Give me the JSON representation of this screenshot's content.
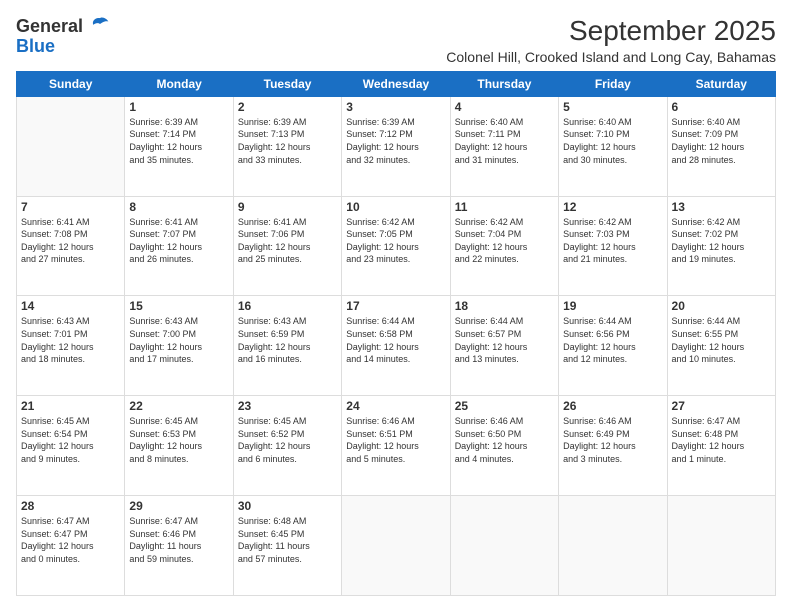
{
  "header": {
    "logo": {
      "general": "General",
      "blue": "Blue"
    },
    "title": "September 2025",
    "subtitle": "Colonel Hill, Crooked Island and Long Cay, Bahamas"
  },
  "calendar": {
    "days_of_week": [
      "Sunday",
      "Monday",
      "Tuesday",
      "Wednesday",
      "Thursday",
      "Friday",
      "Saturday"
    ],
    "weeks": [
      [
        {
          "day": "",
          "info": ""
        },
        {
          "day": "1",
          "info": "Sunrise: 6:39 AM\nSunset: 7:14 PM\nDaylight: 12 hours\nand 35 minutes."
        },
        {
          "day": "2",
          "info": "Sunrise: 6:39 AM\nSunset: 7:13 PM\nDaylight: 12 hours\nand 33 minutes."
        },
        {
          "day": "3",
          "info": "Sunrise: 6:39 AM\nSunset: 7:12 PM\nDaylight: 12 hours\nand 32 minutes."
        },
        {
          "day": "4",
          "info": "Sunrise: 6:40 AM\nSunset: 7:11 PM\nDaylight: 12 hours\nand 31 minutes."
        },
        {
          "day": "5",
          "info": "Sunrise: 6:40 AM\nSunset: 7:10 PM\nDaylight: 12 hours\nand 30 minutes."
        },
        {
          "day": "6",
          "info": "Sunrise: 6:40 AM\nSunset: 7:09 PM\nDaylight: 12 hours\nand 28 minutes."
        }
      ],
      [
        {
          "day": "7",
          "info": "Sunrise: 6:41 AM\nSunset: 7:08 PM\nDaylight: 12 hours\nand 27 minutes."
        },
        {
          "day": "8",
          "info": "Sunrise: 6:41 AM\nSunset: 7:07 PM\nDaylight: 12 hours\nand 26 minutes."
        },
        {
          "day": "9",
          "info": "Sunrise: 6:41 AM\nSunset: 7:06 PM\nDaylight: 12 hours\nand 25 minutes."
        },
        {
          "day": "10",
          "info": "Sunrise: 6:42 AM\nSunset: 7:05 PM\nDaylight: 12 hours\nand 23 minutes."
        },
        {
          "day": "11",
          "info": "Sunrise: 6:42 AM\nSunset: 7:04 PM\nDaylight: 12 hours\nand 22 minutes."
        },
        {
          "day": "12",
          "info": "Sunrise: 6:42 AM\nSunset: 7:03 PM\nDaylight: 12 hours\nand 21 minutes."
        },
        {
          "day": "13",
          "info": "Sunrise: 6:42 AM\nSunset: 7:02 PM\nDaylight: 12 hours\nand 19 minutes."
        }
      ],
      [
        {
          "day": "14",
          "info": "Sunrise: 6:43 AM\nSunset: 7:01 PM\nDaylight: 12 hours\nand 18 minutes."
        },
        {
          "day": "15",
          "info": "Sunrise: 6:43 AM\nSunset: 7:00 PM\nDaylight: 12 hours\nand 17 minutes."
        },
        {
          "day": "16",
          "info": "Sunrise: 6:43 AM\nSunset: 6:59 PM\nDaylight: 12 hours\nand 16 minutes."
        },
        {
          "day": "17",
          "info": "Sunrise: 6:44 AM\nSunset: 6:58 PM\nDaylight: 12 hours\nand 14 minutes."
        },
        {
          "day": "18",
          "info": "Sunrise: 6:44 AM\nSunset: 6:57 PM\nDaylight: 12 hours\nand 13 minutes."
        },
        {
          "day": "19",
          "info": "Sunrise: 6:44 AM\nSunset: 6:56 PM\nDaylight: 12 hours\nand 12 minutes."
        },
        {
          "day": "20",
          "info": "Sunrise: 6:44 AM\nSunset: 6:55 PM\nDaylight: 12 hours\nand 10 minutes."
        }
      ],
      [
        {
          "day": "21",
          "info": "Sunrise: 6:45 AM\nSunset: 6:54 PM\nDaylight: 12 hours\nand 9 minutes."
        },
        {
          "day": "22",
          "info": "Sunrise: 6:45 AM\nSunset: 6:53 PM\nDaylight: 12 hours\nand 8 minutes."
        },
        {
          "day": "23",
          "info": "Sunrise: 6:45 AM\nSunset: 6:52 PM\nDaylight: 12 hours\nand 6 minutes."
        },
        {
          "day": "24",
          "info": "Sunrise: 6:46 AM\nSunset: 6:51 PM\nDaylight: 12 hours\nand 5 minutes."
        },
        {
          "day": "25",
          "info": "Sunrise: 6:46 AM\nSunset: 6:50 PM\nDaylight: 12 hours\nand 4 minutes."
        },
        {
          "day": "26",
          "info": "Sunrise: 6:46 AM\nSunset: 6:49 PM\nDaylight: 12 hours\nand 3 minutes."
        },
        {
          "day": "27",
          "info": "Sunrise: 6:47 AM\nSunset: 6:48 PM\nDaylight: 12 hours\nand 1 minute."
        }
      ],
      [
        {
          "day": "28",
          "info": "Sunrise: 6:47 AM\nSunset: 6:47 PM\nDaylight: 12 hours\nand 0 minutes."
        },
        {
          "day": "29",
          "info": "Sunrise: 6:47 AM\nSunset: 6:46 PM\nDaylight: 11 hours\nand 59 minutes."
        },
        {
          "day": "30",
          "info": "Sunrise: 6:48 AM\nSunset: 6:45 PM\nDaylight: 11 hours\nand 57 minutes."
        },
        {
          "day": "",
          "info": ""
        },
        {
          "day": "",
          "info": ""
        },
        {
          "day": "",
          "info": ""
        },
        {
          "day": "",
          "info": ""
        }
      ]
    ]
  }
}
